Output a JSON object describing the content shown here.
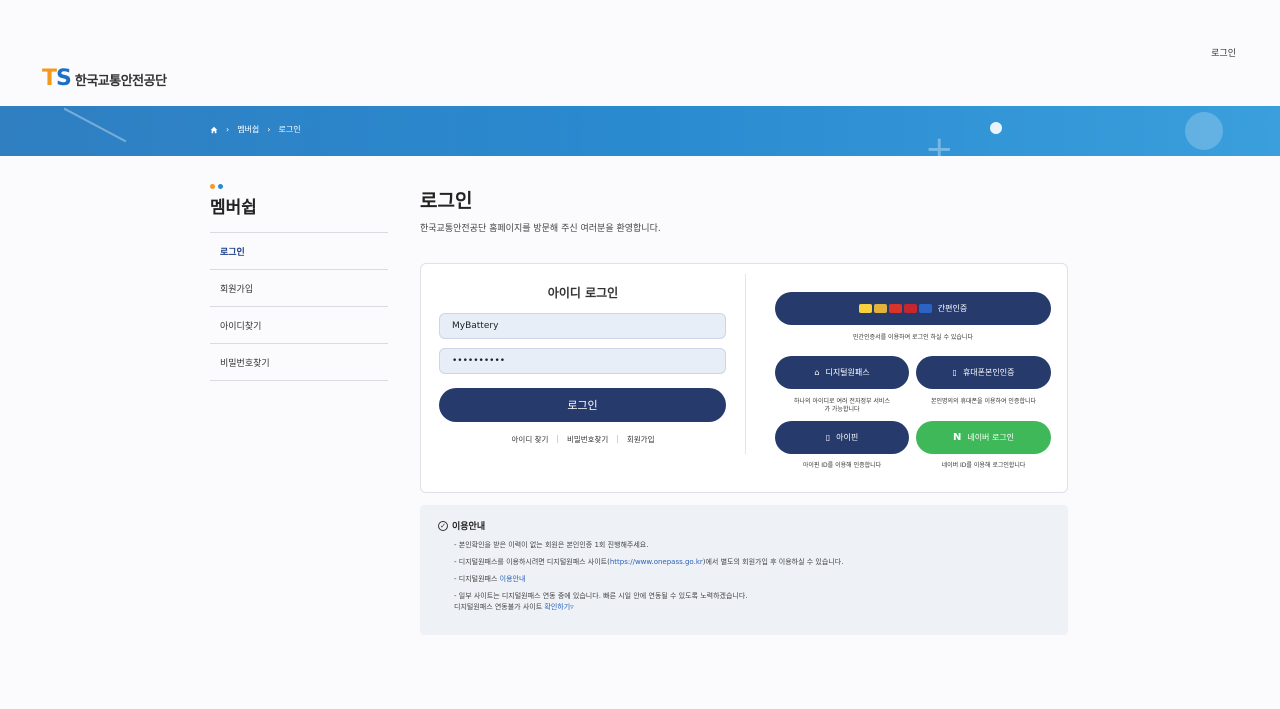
{
  "header": {
    "top_login": "로그인",
    "logo_mark_t": "T",
    "logo_mark_s": "S",
    "logo_text": "한국교통안전공단"
  },
  "breadcrumb": [
    "멤버쉽",
    "로그인"
  ],
  "sidebar": {
    "title": "멤버쉽",
    "items": [
      {
        "label": "로그인",
        "active": true
      },
      {
        "label": "회원가입"
      },
      {
        "label": "아이디찾기"
      },
      {
        "label": "비밀번호찾기"
      }
    ]
  },
  "page": {
    "title": "로그인",
    "subtitle": "한국교통안전공단 홈페이지를 방문해 주신 여러분을 환영합니다."
  },
  "id_login": {
    "title": "아이디 로그인",
    "id_value": "MyBattery",
    "password_value": "••••••••••",
    "login_button": "로그인",
    "links": [
      "아이디 찾기",
      "비밀번호찾기",
      "회원가입"
    ]
  },
  "alt_login": {
    "simple_auth": "간편인증",
    "simple_auth_caption": "민간인증서를 이용하여 로그인 하실 수 있습니다",
    "digital_onepass": "디지털원패스",
    "digital_caption_1": "하나의 아이디로 여러 전자정부 서비스",
    "digital_caption_2": "가 가능합니다",
    "phone_auth": "휴대폰본인인증",
    "phone_caption": "본인명의의 휴대폰을 이용하여 인증합니다",
    "ipin": "아이핀",
    "ipin_caption": "아이핀 ID를 이용해 인증합니다",
    "naver": "네이버 로그인",
    "naver_caption": "네이버 ID를 이용해 로그인합니다"
  },
  "info": {
    "title": "이용안내",
    "item1": "본인확인을 받은 이력이 없는 회원은 본인인증 1회 진행해주세요.",
    "item2_a": "디지털원패스를 이용하시려면 디지털원패스 사이트(",
    "item2_link": "https://www.onepass.go.kr",
    "item2_b": ")에서 별도의 회원가입 후 이용하실 수 있습니다.",
    "item3_a": "디지털원패스 ",
    "item3_link": "이용안내",
    "item4_a": "일부 사이트는 디지털원패스 연동 중에 있습니다. 빠른 시일 안에 연동될 수 있도록 노력하겠습니다.",
    "item4_b": "디지털원패스 연동불가 사이트 ",
    "item4_link": "확인하기"
  },
  "colors": {
    "navy": "#263a6c",
    "naver_green": "#3fb85a",
    "banner_blue": "#2a8ad0",
    "logo_orange": "#f39a1e",
    "logo_blue": "#1b6fc6"
  }
}
